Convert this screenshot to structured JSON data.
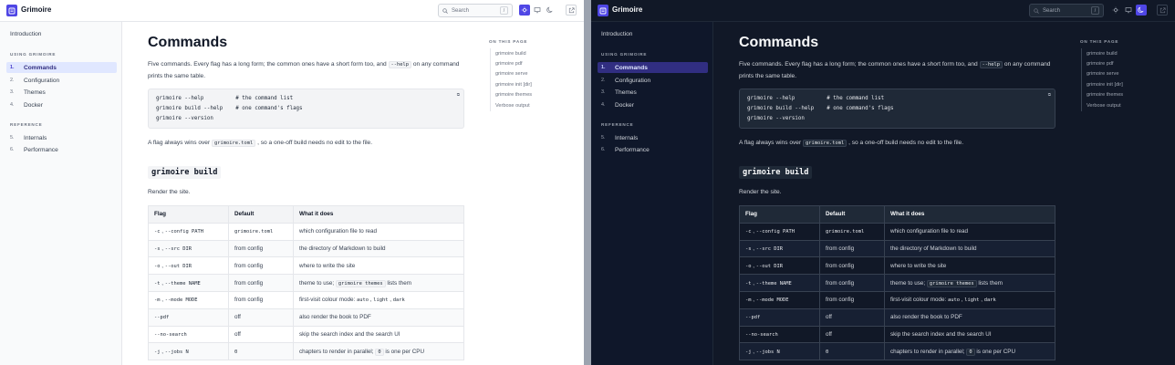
{
  "app": {
    "name": "Grimoire"
  },
  "search": {
    "placeholder": "Search",
    "shortcut": "/"
  },
  "theme_buttons": [
    "light-theme-icon",
    "system-theme-icon",
    "dark-theme-icon"
  ],
  "github_icon": "external-link-icon",
  "sidebar": {
    "intro": "Introduction",
    "sections": [
      {
        "title": "Using Grimoire",
        "items": [
          {
            "num": "1.",
            "label": "Commands"
          },
          {
            "num": "2.",
            "label": "Configuration"
          },
          {
            "num": "3.",
            "label": "Themes"
          },
          {
            "num": "4.",
            "label": "Docker"
          }
        ]
      },
      {
        "title": "Reference",
        "items": [
          {
            "num": "5.",
            "label": "Internals"
          },
          {
            "num": "6.",
            "label": "Performance"
          }
        ]
      }
    ]
  },
  "page": {
    "title": "Commands",
    "intro_1": "Five commands. Every flag has a long form; the common ones have a short form too, and",
    "intro_code": "--help",
    "intro_2": "on any command prints the same table.",
    "code_lines": [
      "grimoire --help          # the command list",
      "grimoire build --help    # one command's flags",
      "grimoire --version"
    ],
    "copy_label": "⧉",
    "flag_note_1": "A flag always wins over",
    "flag_note_code": "grimoire.toml",
    "flag_note_2": ", so a one-off build needs no edit to the file.",
    "section_heading": "grimoire build",
    "section_desc": "Render the site.",
    "table": {
      "headers": [
        "Flag",
        "Default",
        "What it does"
      ],
      "rows": [
        {
          "short": "-c",
          "long": "--config PATH",
          "default": "grimoire.toml",
          "default_code": true,
          "desc": "which configuration file to read"
        },
        {
          "short": "-s",
          "long": "--src DIR",
          "default": "from config",
          "default_code": false,
          "desc": "the directory of Markdown to build"
        },
        {
          "short": "-o",
          "long": "--out DIR",
          "default": "from config",
          "default_code": false,
          "desc": "where to write the site"
        },
        {
          "short": "-t",
          "long": "--theme NAME",
          "default": "from config",
          "default_code": false,
          "desc_1": "theme to use;",
          "desc_code": "grimoire themes",
          "desc_2": "lists them"
        },
        {
          "short": "-m",
          "long": "--mode MODE",
          "default": "from config",
          "default_code": false,
          "desc_1": "first-visit colour mode:",
          "modes": [
            "auto",
            "light",
            "dark"
          ]
        },
        {
          "short": "",
          "long": "--pdf",
          "default": "off",
          "default_code": false,
          "desc": "also render the book to PDF"
        },
        {
          "short": "",
          "long": "--no-search",
          "default": "off",
          "default_code": false,
          "desc": "skip the search index and the search UI"
        },
        {
          "short": "-j",
          "long": "--jobs N",
          "default": "0",
          "default_code": true,
          "desc_1": "chapters to render in parallel;",
          "desc_code": "0",
          "desc_2": "is one per CPU"
        }
      ]
    }
  },
  "toc": {
    "heading": "On this page",
    "items": [
      "grimoire build",
      "grimoire pdf",
      "grimoire serve",
      "grimoire init [dir]",
      "grimoire themes",
      "Verbose output"
    ]
  },
  "colors": {
    "accent": "#4f46e5",
    "dark_bg": "#111827"
  }
}
